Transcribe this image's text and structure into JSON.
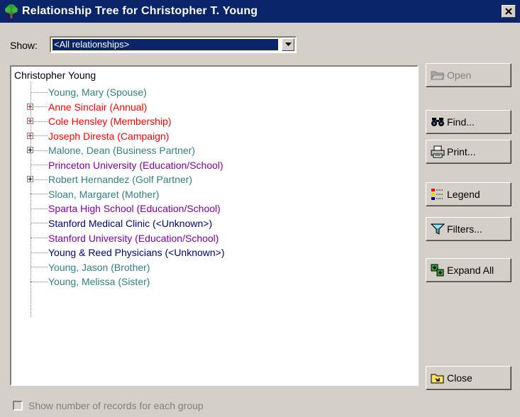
{
  "window": {
    "title": "Relationship Tree for Christopher T. Young",
    "close_glyph": "✕",
    "icon": "tree-icon"
  },
  "show": {
    "label": "Show:",
    "selected": "<All relationships>"
  },
  "tree": {
    "root": "Christopher Young",
    "items": [
      {
        "label": "Young, Mary (Spouse)",
        "color": "#2f8080",
        "expandable": false
      },
      {
        "label": "Anne Sinclair (Annual)",
        "color": "#ff0000",
        "expandable": true
      },
      {
        "label": "Cole Hensley (Membership)",
        "color": "#ff0000",
        "expandable": true
      },
      {
        "label": "Joseph Diresta (Campaign)",
        "color": "#ff0000",
        "expandable": true
      },
      {
        "label": "Malone, Dean (Business Partner)",
        "color": "#2f8080",
        "expandable": true
      },
      {
        "label": "Princeton University (Education/School)",
        "color": "#8000a0",
        "expandable": false
      },
      {
        "label": "Robert Hernandez (Golf Partner)",
        "color": "#2f8080",
        "expandable": true
      },
      {
        "label": "Sloan, Margaret (Mother)",
        "color": "#2f8080",
        "expandable": false
      },
      {
        "label": "Sparta High School (Education/School)",
        "color": "#8000a0",
        "expandable": false
      },
      {
        "label": "Stanford Medical Clinic (<Unknown>)",
        "color": "#000080",
        "expandable": false
      },
      {
        "label": "Stanford University (Education/School)",
        "color": "#8000a0",
        "expandable": false
      },
      {
        "label": "Young & Reed Physicians (<Unknown>)",
        "color": "#000080",
        "expandable": false
      },
      {
        "label": "Young, Jason (Brother)",
        "color": "#2f8080",
        "expandable": false
      },
      {
        "label": "Young, Melissa (Sister)",
        "color": "#2f8080",
        "expandable": false
      }
    ]
  },
  "buttons": {
    "open": "Open",
    "find": "Find...",
    "print": "Print...",
    "legend": "Legend",
    "filters": "Filters...",
    "expand_all": "Expand All",
    "close": "Close"
  },
  "footer": {
    "checkbox_label": "Show number of records for each group",
    "checked": false
  }
}
